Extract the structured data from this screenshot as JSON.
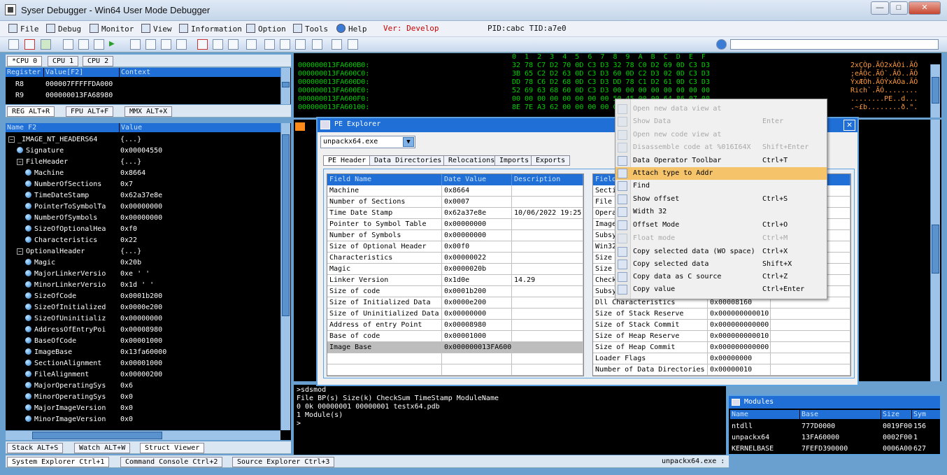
{
  "window": {
    "title": "Syser Debugger - Win64 User Mode Debugger",
    "min": "—",
    "max": "□",
    "close": "✕"
  },
  "menu": {
    "file": "File",
    "debug": "Debug",
    "monitor": "Monitor",
    "view": "View",
    "information": "Information",
    "option": "Option",
    "tools": "Tools",
    "help": "Help",
    "version": "Ver: Develop",
    "pid_tid": "PID:cabc TID:a7e0"
  },
  "cpu_tabs": [
    "*CPU 0",
    "CPU 1",
    "CPU 2"
  ],
  "registers": {
    "headers": [
      "Register",
      "Value[F2]",
      "Context"
    ],
    "rows": [
      [
        "R8",
        "000007FFFFFDA000"
      ],
      [
        "R9",
        "000000013FA68980"
      ]
    ],
    "tabs": [
      "REG ALT+R",
      "FPU ALT+F",
      "MMX ALT+X"
    ]
  },
  "struct_viewer": {
    "headers": [
      "Name F2",
      "Value"
    ],
    "rows": [
      [
        "_IMAGE_NT_HEADERS64",
        "{...}"
      ],
      [
        "Signature",
        "0x00004550"
      ],
      [
        "FileHeader",
        "{...}"
      ],
      [
        "Machine",
        "0x8664"
      ],
      [
        "NumberOfSections",
        "0x7"
      ],
      [
        "TimeDateStamp",
        "0x62a37e8e"
      ],
      [
        "PointerToSymbolTa",
        "0x00000000"
      ],
      [
        "NumberOfSymbols",
        "0x00000000"
      ],
      [
        "SizeOfOptionalHea",
        "0xf0"
      ],
      [
        "Characteristics",
        "0x22"
      ],
      [
        "OptionalHeader",
        "{...}"
      ],
      [
        "Magic",
        "0x20b"
      ],
      [
        "MajorLinkerVersio",
        "0xe ' '"
      ],
      [
        "MinorLinkerVersio",
        "0x1d ' '"
      ],
      [
        "SizeOfCode",
        "0x0001b200"
      ],
      [
        "SizeOfInitialized",
        "0x0000e200"
      ],
      [
        "SizeOfUninitializ",
        "0x00000000"
      ],
      [
        "AddressOfEntryPoi",
        "0x00008980"
      ],
      [
        "BaseOfCode",
        "0x00001000"
      ],
      [
        "ImageBase",
        "0x13fa60000"
      ],
      [
        "SectionAlignment",
        "0x00001000"
      ],
      [
        "FileAlignment",
        "0x00000200"
      ],
      [
        "MajorOperatingSys",
        "0x6"
      ],
      [
        "MinorOperatingSys",
        "0x0"
      ],
      [
        "MajorImageVersion",
        "0x0"
      ],
      [
        "MinorImageVersion",
        "0x0"
      ]
    ],
    "tabs": [
      "Stack ALT+S",
      "Watch ALT+W",
      "Struct Viewer"
    ]
  },
  "bottom_tabs": [
    "System Explorer Ctrl+1",
    "Command Console Ctrl+2",
    "Source Explorer Ctrl+3"
  ],
  "status_module": "unpackx64.exe :",
  "hex": {
    "header": "0  1  2  3  4  5  6  7  8  9  A  B  C  D  E  F",
    "rows": [
      [
        "000000013FA600B0:",
        "32 78 C7 D2 70 0D C3 D3 32 78 C0 D2 69 0D C3 D3",
        "2xÇÒp.ÃÓ2xÀÒi.ÃÓ"
      ],
      [
        "000000013FA600C0:",
        "3B 65 C2 D2 63 0D C3 D3 60 0D C2 D3 02 0D C3 D3",
        ";eÂÒc.ÃÓ`.ÂÓ..ÃÓ"
      ],
      [
        "000000013FA600D0:",
        "DD 78 C6 D2 68 0D C3 D3 DD 78 C1 D2 61 0D C3 D3",
        "ÝxÆÒh.ÃÓÝxÁÒa.ÃÓ"
      ],
      [
        "000000013FA600E0:",
        "52 69 63 68 60 0D C3 D3 00 00 00 00 00 00 00 00",
        "Rich`.ÃÓ........"
      ],
      [
        "000000013FA600F0:",
        "00 00 00 00 00 00 00 00 50 45 00 00 64 86 07 00",
        "........PE..d..."
      ],
      [
        "000000013FA60100:",
        "8E 7E A3 62 00 00 00 00 00 00 00 00 F0 00 22 00",
        ".~£b........ð.\"."
      ]
    ]
  },
  "pe_explorer": {
    "title": "PE Explorer",
    "file": "unpackx64.exe",
    "tabs": [
      "PE Header",
      "Data Directories",
      "Relocations",
      "Imports",
      "Exports"
    ],
    "headers": [
      "Field Name",
      "Date Value",
      "Description"
    ],
    "rows": [
      [
        "Machine",
        "0x8664",
        ""
      ],
      [
        "Number of Sections",
        "0x0007",
        ""
      ],
      [
        "Time Date Stamp",
        "0x62a37e8e",
        "10/06/2022 19:25"
      ],
      [
        "Pointer to Symbol Table",
        "0x00000000",
        ""
      ],
      [
        "Number of Symbols",
        "0x00000000",
        ""
      ],
      [
        "Size of Optional Header",
        "0x00f0",
        ""
      ],
      [
        "Characteristics",
        "0x00000022",
        ""
      ],
      [
        "Magic",
        "0x0000020b",
        ""
      ],
      [
        "Linker Version",
        "0x1d0e",
        "14.29"
      ],
      [
        "Size of code",
        "0x0001b200",
        ""
      ],
      [
        "Size of Initialized Data",
        "0x0000e200",
        ""
      ],
      [
        "Size of Uninitialized Data",
        "0x00000000",
        ""
      ],
      [
        "Address of entry Point",
        "0x00008980",
        ""
      ],
      [
        "Base of code",
        "0x00001000",
        ""
      ],
      [
        "Image Base",
        "0x000000013FA60000",
        ""
      ]
    ],
    "right_header": "Field",
    "right_rows": [
      [
        "Secti",
        ""
      ],
      [
        "File ",
        ""
      ],
      [
        "Opera",
        ""
      ],
      [
        "Image",
        ""
      ],
      [
        "Subsy",
        ""
      ],
      [
        "Win32",
        ""
      ],
      [
        "Size ",
        ""
      ],
      [
        "Size ",
        ""
      ],
      [
        "Check",
        ""
      ],
      [
        "Subsy",
        ""
      ],
      [
        "Dll Characteristics",
        "0x00008160"
      ],
      [
        "Size of Stack Reserve",
        "0x000000000010"
      ],
      [
        "Size of Stack Commit",
        "0x000000000000"
      ],
      [
        "Size of Heap Reserve",
        "0x000000000010"
      ],
      [
        "Size of Heap Commit",
        "0x000000000000"
      ],
      [
        "Loader Flags",
        "0x00000000"
      ],
      [
        "Number of Data Directories",
        "0x00000010"
      ]
    ]
  },
  "context_menu": [
    {
      "label": "Open new data view at",
      "shortcut": "",
      "disabled": true
    },
    {
      "label": "Show Data",
      "shortcut": "Enter",
      "disabled": true
    },
    {
      "label": "Open new code view at",
      "shortcut": "",
      "disabled": true
    },
    {
      "label": "Disassemble code at %016I64X",
      "shortcut": "Shift+Enter",
      "disabled": true
    },
    {
      "label": "Data Operator Toolbar",
      "shortcut": "Ctrl+T",
      "disabled": false
    },
    {
      "label": "Attach type to Addr",
      "shortcut": "",
      "disabled": false
    },
    {
      "label": "Find",
      "shortcut": "",
      "disabled": false
    },
    {
      "label": "Show offset",
      "shortcut": "Ctrl+S",
      "disabled": false
    },
    {
      "label": "Width 32",
      "shortcut": "",
      "disabled": false
    },
    {
      "label": "Offset Mode",
      "shortcut": "Ctrl+O",
      "disabled": false
    },
    {
      "label": "Float mode",
      "shortcut": "Ctrl+M",
      "disabled": true
    },
    {
      "label": "Copy selected data (WO space)",
      "shortcut": "Ctrl+X",
      "disabled": false
    },
    {
      "label": "Copy selected data",
      "shortcut": "Shift+X",
      "disabled": false
    },
    {
      "label": "Copy data as C source",
      "shortcut": "Ctrl+Z",
      "disabled": false
    },
    {
      "label": "Copy value",
      "shortcut": "Ctrl+Enter",
      "disabled": false
    }
  ],
  "console": {
    "lines": [
      ">sdsmod",
      "File BP(s) Size(k) CheckSum TimeStamp ModuleName",
      "0          0k 00000001 00000001  testx64.pdb",
      "1 Module(s)",
      ">"
    ]
  },
  "modules": {
    "title": "Modules",
    "headers": [
      "Name",
      "Base",
      "Size",
      "Sym"
    ],
    "rows": [
      [
        "ntdll",
        "777D0000",
        "0019F000",
        "156"
      ],
      [
        "unpackx64",
        "13FA60000",
        "0002F000",
        "1"
      ],
      [
        "KERNELBASE",
        "7FEFD390000",
        "0006A000",
        "627"
      ]
    ]
  },
  "colors": {
    "accent": "#1f6fd6",
    "highlight": "#f5c46a",
    "hex_text": "#00d000",
    "version_text": "#cc0000"
  }
}
